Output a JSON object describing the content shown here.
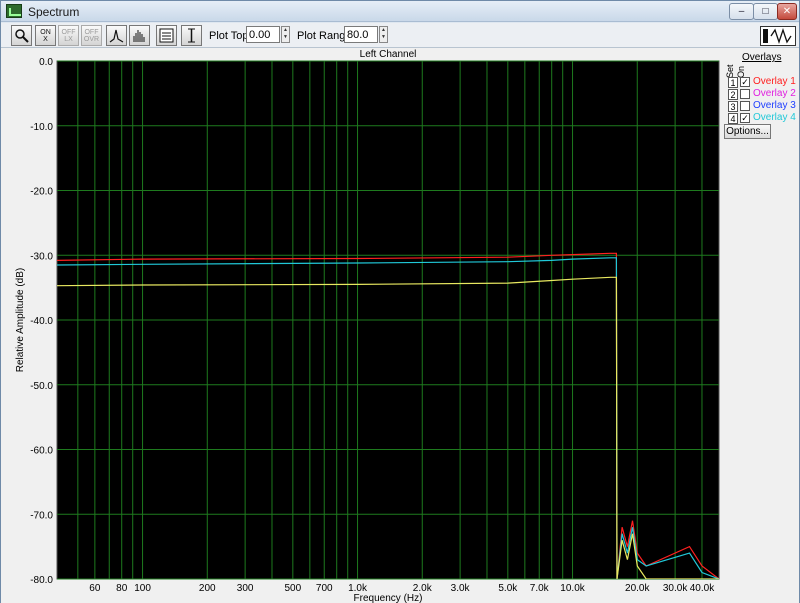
{
  "window": {
    "title": "Spectrum"
  },
  "toolbar": {
    "plot_top_label": "Plot Top:",
    "plot_top_value": "0.00",
    "plot_range_label": "Plot Range:",
    "plot_range_value": "80.0",
    "buttons": [
      "zoom-icon",
      "on-x-icon",
      "off-x-icon",
      "off-y-icon",
      "peak-mode-icon",
      "bar-mode-icon",
      "list-icon",
      "cursor-icon"
    ],
    "button_text": {
      "on_x": "ON\nX",
      "off_1": "OFF\nLX",
      "off_2": "OFF\nOVR"
    }
  },
  "overlays": {
    "title": "Overlays",
    "col_set": "Set",
    "col_on": "On",
    "items": [
      {
        "num": "1",
        "label": "Overlay 1",
        "checked": true,
        "color": "#ff2020"
      },
      {
        "num": "2",
        "label": "Overlay 2",
        "checked": false,
        "color": "#e020e0"
      },
      {
        "num": "3",
        "label": "Overlay 3",
        "checked": false,
        "color": "#2040ff"
      },
      {
        "num": "4",
        "label": "Overlay 4",
        "checked": true,
        "color": "#20c8d8"
      }
    ],
    "options_label": "Options..."
  },
  "chart_data": {
    "type": "line",
    "title": "Left Channel",
    "xlabel": "Frequency (Hz)",
    "ylabel": "Relative Amplitude (dB)",
    "xscale": "log",
    "xlim": [
      40,
      48000
    ],
    "ylim": [
      -80,
      0
    ],
    "grid": true,
    "background": "#000000",
    "grid_color": "#1e7a1e",
    "x_ticks": [
      60,
      80,
      100,
      200,
      300,
      500,
      700,
      1000,
      2000,
      3000,
      5000,
      7000,
      10000,
      20000,
      30000,
      40000
    ],
    "x_tick_labels": [
      "60",
      "80",
      "100",
      "200",
      "300",
      "500",
      "700",
      "1.0k",
      "2.0k",
      "3.0k",
      "5.0k",
      "7.0k",
      "10.0k",
      "20.0k",
      "30.0k",
      "40.0k"
    ],
    "y_ticks": [
      0,
      -10,
      -20,
      -30,
      -40,
      -50,
      -60,
      -70,
      -80
    ],
    "y_tick_labels": [
      "0.0",
      "-10.0",
      "-20.0",
      "-30.0",
      "-40.0",
      "-50.0",
      "-60.0",
      "-70.0",
      "-80.0"
    ],
    "series": [
      {
        "color": "#ff2020",
        "x": [
          40,
          100,
          1000,
          5000,
          8000,
          10000,
          15000,
          16000,
          16100,
          17000,
          18000,
          19000,
          20000,
          22000,
          35000,
          40000,
          48000
        ],
        "y": [
          -30.8,
          -30.6,
          -30.5,
          -30.3,
          -30.0,
          -29.9,
          -29.7,
          -29.7,
          -80,
          -72,
          -75,
          -71,
          -76,
          -78,
          -75,
          -78,
          -80
        ]
      },
      {
        "color": "#20c8d8",
        "x": [
          40,
          100,
          1000,
          5000,
          8000,
          10000,
          15000,
          16000,
          16100,
          17000,
          18000,
          19000,
          20000,
          22000,
          35000,
          40000,
          48000
        ],
        "y": [
          -31.5,
          -31.4,
          -31.2,
          -31.0,
          -30.8,
          -30.6,
          -30.4,
          -30.4,
          -80,
          -73,
          -76,
          -72,
          -77,
          -78,
          -76,
          -79,
          -80
        ]
      },
      {
        "color": "#e8e860",
        "x": [
          40,
          100,
          1000,
          5000,
          8000,
          10000,
          15000,
          16000,
          16100,
          17000,
          18000,
          19000,
          20000,
          22000,
          48000
        ],
        "y": [
          -34.7,
          -34.6,
          -34.5,
          -34.3,
          -33.9,
          -33.7,
          -33.4,
          -33.4,
          -80,
          -74,
          -77,
          -73,
          -78,
          -80,
          -80
        ]
      }
    ]
  }
}
